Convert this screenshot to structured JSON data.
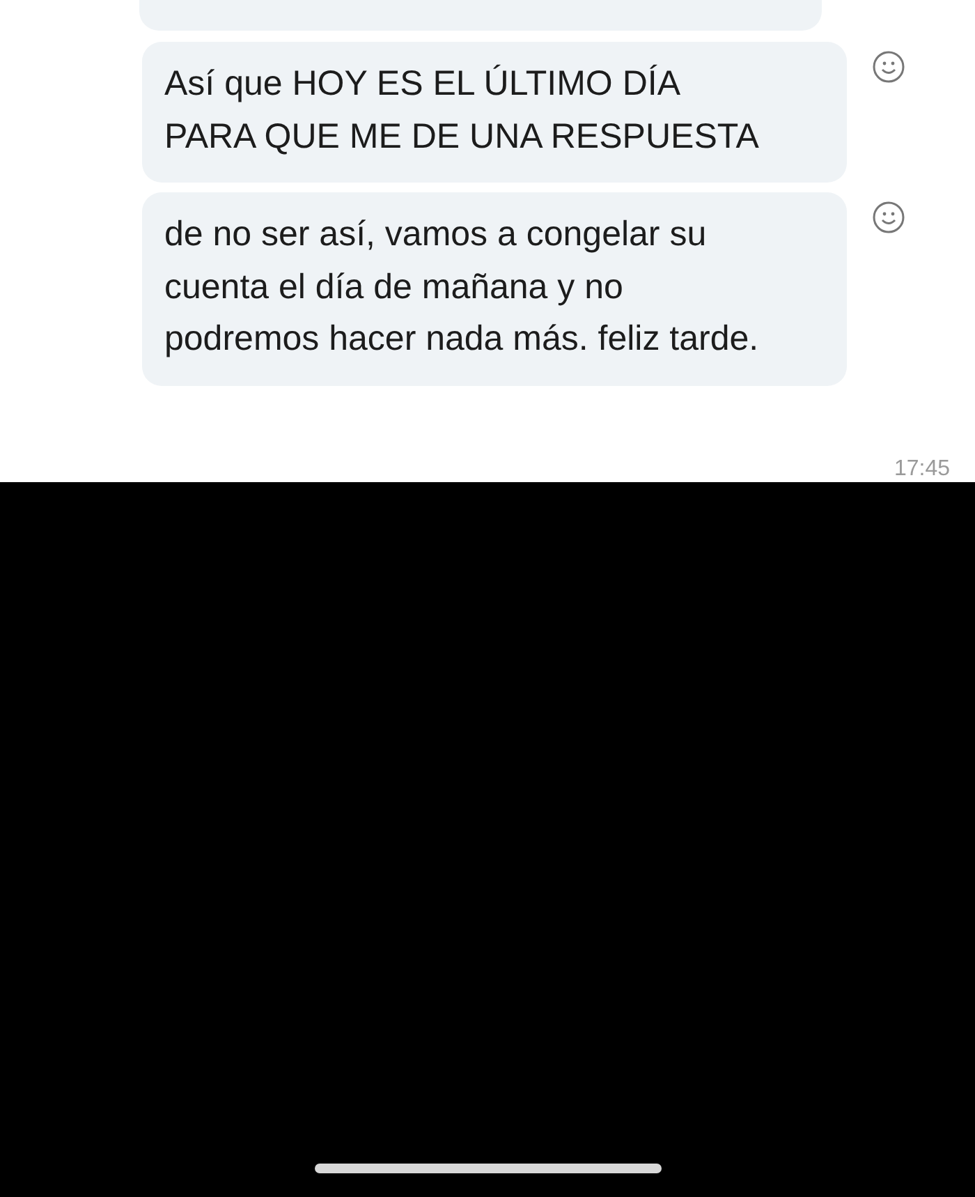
{
  "messages": [
    {
      "partial": true
    },
    {
      "text": "Así que HOY ES EL ÚLTIMO DÍA PARA QUE ME DE UNA RESPUESTA",
      "partial": false
    },
    {
      "text": "de no ser así, vamos a congelar su cuenta el día de mañana y no podremos hacer nada más. feliz tarde.",
      "partial": false
    }
  ],
  "time": "17:45"
}
